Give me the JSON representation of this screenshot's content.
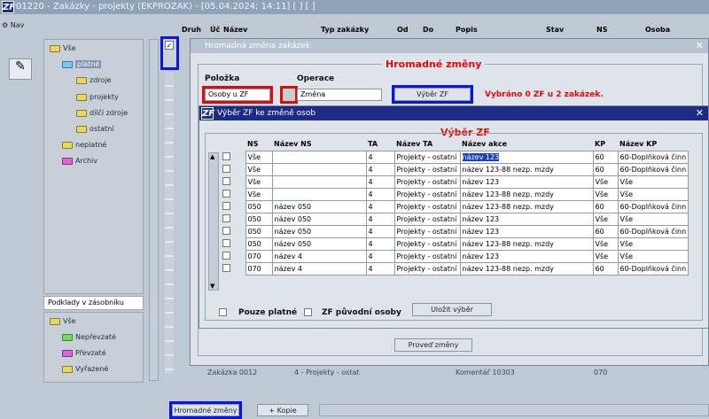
{
  "window": {
    "title": "01220 - Zakázky - projekty (EKPROZAK) - [05.04.2024; 14:11] [ ] [ ]",
    "logo": "ZF"
  },
  "nav_label": "Nav",
  "tree_top": {
    "root": "Vše",
    "items": [
      "platné",
      "zdroje",
      "projekty",
      "dílčí zdroje",
      "ostatní",
      "neplatné",
      "Archiv"
    ]
  },
  "buffer": {
    "title": "Podklady v zásobníku",
    "root": "Vše",
    "items": [
      "Nepřevzaté",
      "Převzaté",
      "Vyřazené"
    ]
  },
  "grid_headers": [
    "Druh",
    "Úč",
    "Název",
    "Typ zakázky",
    "Od",
    "Do",
    "Popis",
    "Stav",
    "NS",
    "Osoba"
  ],
  "bg_row": [
    "Zakázka 0012",
    "4 - Projekty - ostat",
    "Komentář 10303",
    "070"
  ],
  "bottom": {
    "mass_change": "Hromadné změny",
    "copy": "+ Kopie"
  },
  "dlg1": {
    "title": "Hromadná změna zakázek",
    "legend": "Hromadné změny",
    "polozka_label": "Položka",
    "polozka_value": "Osoby u ZF",
    "operace_label": "Operace",
    "operace_value": "Změna",
    "vyber_btn": "Výběr ZF",
    "status": "Vybráno 0 ZF u 2 zakázek.",
    "execute_btn": "Proveď změny"
  },
  "dlg2": {
    "title": "Výběr ZF ke změně osob",
    "legend": "Výběr ZF",
    "columns": [
      "NS",
      "Název NS",
      "TA",
      "Název TA",
      "Název akce",
      "KP",
      "Název KP"
    ],
    "rows": [
      [
        "Vše",
        "",
        "4",
        "Projekty - ostatní",
        "název 123",
        "60",
        "60-Doplňková činn"
      ],
      [
        "Vše",
        "",
        "4",
        "Projekty - ostatní",
        "název 123-88 nezp. mzdy",
        "60",
        "60-Doplňková činn"
      ],
      [
        "Vše",
        "",
        "4",
        "Projekty - ostatní",
        "název 123",
        "Vše",
        "Vše"
      ],
      [
        "Vše",
        "",
        "4",
        "Projekty - ostatní",
        "název 123-88 nezp. mzdy",
        "Vše",
        "Vše"
      ],
      [
        "050",
        "název 050",
        "4",
        "Projekty - ostatní",
        "název 123-88 nezp. mzdy",
        "60",
        "60-Doplňková činn"
      ],
      [
        "050",
        "název 050",
        "4",
        "Projekty - ostatní",
        "název 123",
        "Vše",
        "Vše"
      ],
      [
        "050",
        "název 050",
        "4",
        "Projekty - ostatní",
        "název 123",
        "60",
        "60-Doplňková činn"
      ],
      [
        "050",
        "název 050",
        "4",
        "Projekty - ostatní",
        "název 123-88 nezp. mzdy",
        "Vše",
        "Vše"
      ],
      [
        "070",
        "název 4",
        "4",
        "Projekty - ostatní",
        "název 123",
        "Vše",
        "Vše"
      ],
      [
        "070",
        "název 4",
        "4",
        "Projekty - ostatní",
        "název 123-88 nezp. mzdy",
        "60",
        "60-Doplňková činn"
      ]
    ],
    "only_valid": "Pouze platné",
    "orig_persons": "ZF původní osoby",
    "save_btn": "Uložit výběr"
  },
  "colors": {
    "highlight_blue": "#0a14e6",
    "highlight_red": "#e10a0a",
    "dialog_title": "#1d2b86"
  }
}
